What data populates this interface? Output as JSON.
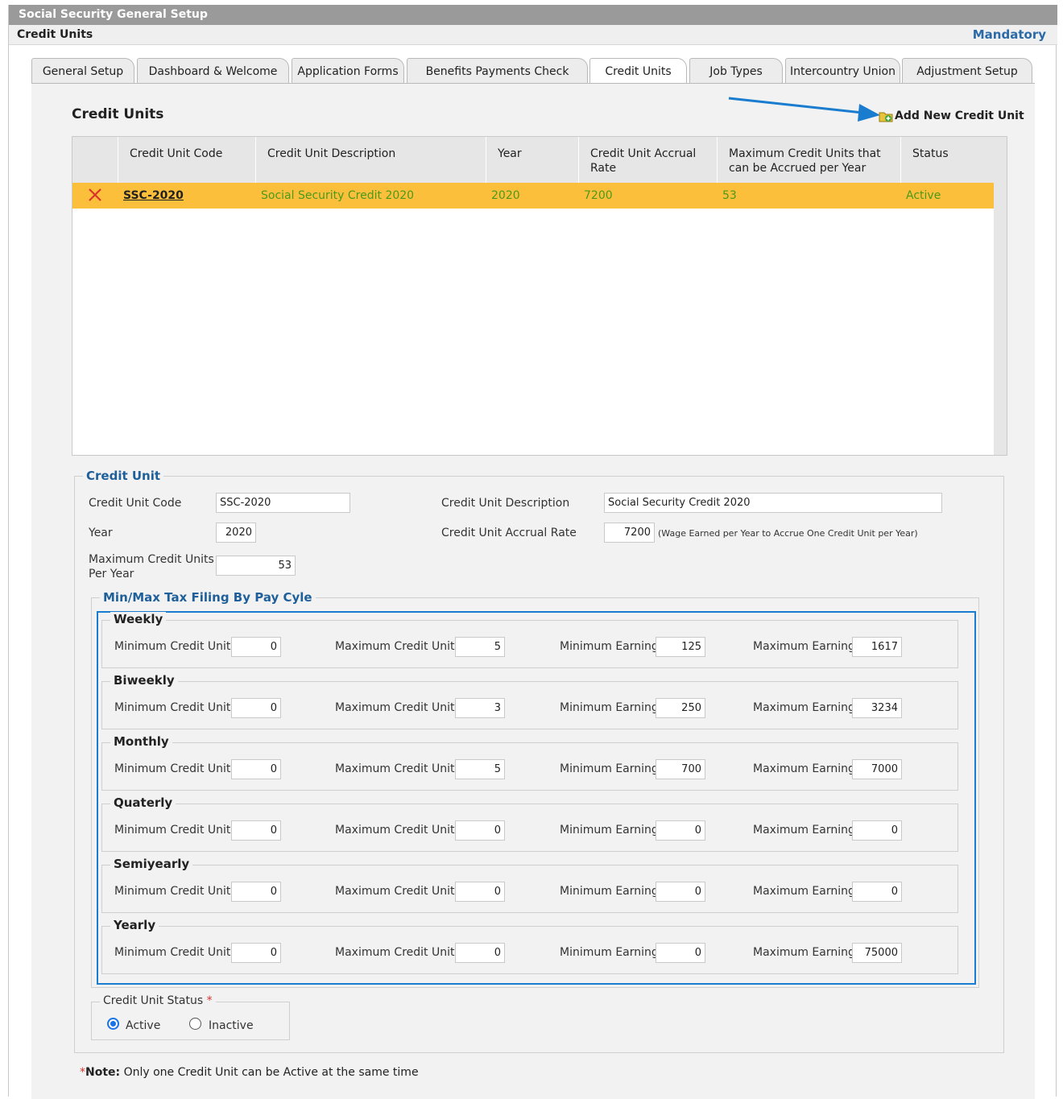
{
  "header": {
    "app_title": "Social Security General Setup",
    "section": "Credit Units",
    "mandatory": "Mandatory"
  },
  "tabs": [
    {
      "label": "General Setup"
    },
    {
      "label": "Dashboard & Welcome Text"
    },
    {
      "label": "Application Forms"
    },
    {
      "label": "Benefits Payments Check Printers"
    },
    {
      "label": "Credit Units"
    },
    {
      "label": "Job Types"
    },
    {
      "label": "Intercountry Union"
    },
    {
      "label": "Adjustment Setup"
    }
  ],
  "active_tab": "Credit Units",
  "list": {
    "title": "Credit Units",
    "add_label": "Add New Credit Unit",
    "columns": [
      "Credit Unit Code",
      "Credit Unit Description",
      "Year",
      "Credit Unit Accrual Rate",
      "Maximum Credit Units that can be Accrued per Year",
      "Status"
    ],
    "rows": [
      {
        "code": "SSC-2020",
        "description": "Social Security Credit 2020",
        "year": "2020",
        "rate": "7200",
        "max_units": "53",
        "status": "Active"
      }
    ]
  },
  "form": {
    "legend": "Credit Unit",
    "code_label": "Credit Unit Code",
    "code_value": "SSC-2020",
    "desc_label": "Credit Unit Description",
    "desc_value": "Social Security Credit 2020",
    "year_label": "Year",
    "year_value": "2020",
    "rate_label": "Credit Unit Accrual Rate",
    "rate_value": "7200",
    "rate_hint": "(Wage Earned per Year to Accrue One Credit Unit per Year)",
    "max_label_1": "Maximum Credit Units",
    "max_label_2": "Per Year",
    "max_value": "53"
  },
  "tax_filing": {
    "legend": "Min/Max Tax Filing By Pay Cyle",
    "labels": {
      "min_units": "Minimum Credit Units",
      "max_units": "Maximum Credit Units",
      "min_earning": "Minimum Earning",
      "max_earning": "Maximum Earning"
    },
    "cycles": [
      {
        "name": "Weekly",
        "min_units": "0",
        "max_units": "5",
        "min_earning": "125",
        "max_earning": "1617"
      },
      {
        "name": "Biweekly",
        "min_units": "0",
        "max_units": "3",
        "min_earning": "250",
        "max_earning": "3234"
      },
      {
        "name": "Monthly",
        "min_units": "0",
        "max_units": "5",
        "min_earning": "700",
        "max_earning": "7000"
      },
      {
        "name": "Quaterly",
        "min_units": "0",
        "max_units": "0",
        "min_earning": "0",
        "max_earning": "0"
      },
      {
        "name": "Semiyearly",
        "min_units": "0",
        "max_units": "0",
        "min_earning": "0",
        "max_earning": "0"
      },
      {
        "name": "Yearly",
        "min_units": "0",
        "max_units": "0",
        "min_earning": "0",
        "max_earning": "75000"
      }
    ]
  },
  "status": {
    "legend": "Credit Unit Status",
    "required_mark": "*",
    "options": [
      "Active",
      "Inactive"
    ],
    "selected": "Active"
  },
  "note": {
    "mark": "*",
    "prefix": "Note:",
    "text": " Only one Credit Unit can be Active at the same time"
  },
  "colors": {
    "accent": "#2b6aa8",
    "row_highlight": "#fcbf3b",
    "row_text": "#4a9a1a",
    "highlight_box": "#1a7ccf",
    "arrow": "#1a7ccf",
    "required": "#d9322b"
  }
}
